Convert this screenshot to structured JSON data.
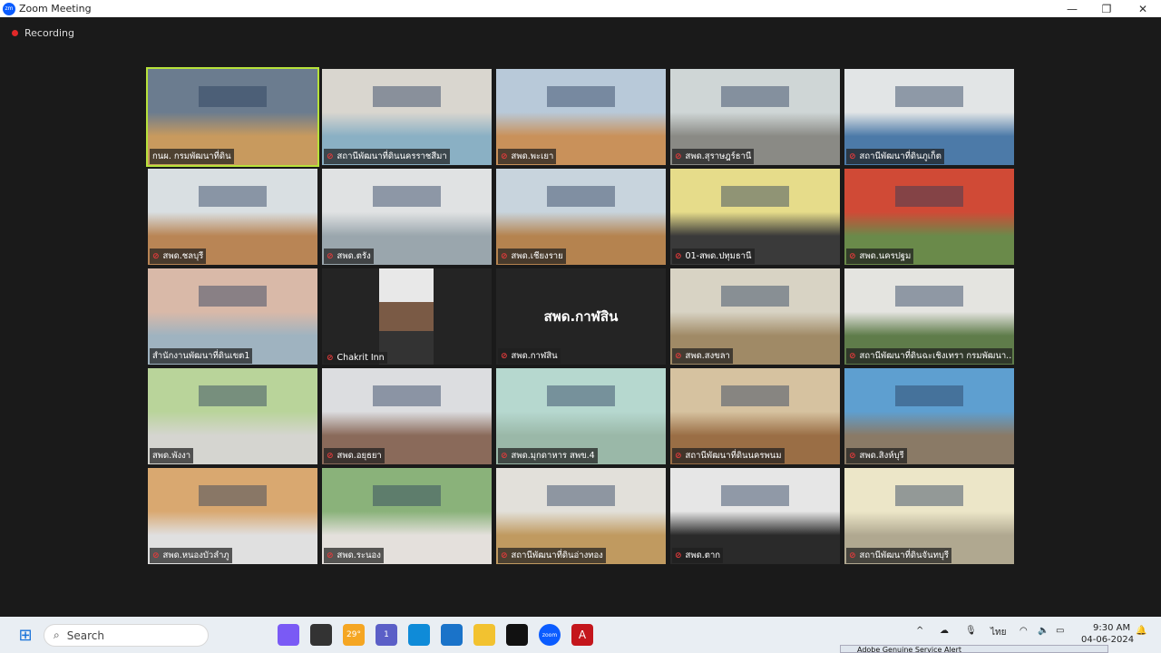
{
  "window": {
    "title": "Zoom Meeting",
    "minimize": "—",
    "maximize": "❐",
    "close": "✕"
  },
  "recording": {
    "label": "Recording",
    "color": "#e02828"
  },
  "active_color": "#b7e23a",
  "tiles": [
    {
      "name": "กนผ. กรมพัฒนาที่ดิน",
      "muted": false,
      "active": true,
      "room": [
        "#6b7c8f",
        "#c89a5e"
      ]
    },
    {
      "name": "สถานีพัฒนาที่ดินนครราชสีมา",
      "muted": true,
      "room": [
        "#d9d6cf",
        "#8ab0c4"
      ]
    },
    {
      "name": "สพด.พะเยา",
      "muted": true,
      "room": [
        "#b8c9d9",
        "#c9915a"
      ]
    },
    {
      "name": "สพด.สุราษฎร์ธานี",
      "muted": true,
      "room": [
        "#cfd6d6",
        "#8a8a85"
      ]
    },
    {
      "name": "สถานีพัฒนาที่ดินภูเก็ต",
      "muted": true,
      "room": [
        "#e2e5e6",
        "#4c7aa8"
      ]
    },
    {
      "name": "สพด.ชลบุรี",
      "muted": true,
      "room": [
        "#d9dfe2",
        "#b98555"
      ]
    },
    {
      "name": "สพด.ตรัง",
      "muted": true,
      "room": [
        "#e0e2e3",
        "#9aa6ad"
      ]
    },
    {
      "name": "สพด.เชียงราย",
      "muted": true,
      "room": [
        "#c8d4dd",
        "#b5834f"
      ]
    },
    {
      "name": "01-สพด.ปทุมธานี",
      "muted": true,
      "room": [
        "#e6dc8a",
        "#3a3a3a"
      ]
    },
    {
      "name": "สพด.นครปฐม",
      "muted": true,
      "room": [
        "#d04a36",
        "#6a8a4a"
      ]
    },
    {
      "name": "สำนักงานพัฒนาที่ดินเขต1",
      "muted": false,
      "room": [
        "#d9b9a8",
        "#9fb3c0"
      ]
    },
    {
      "name": "Chakrit Inn",
      "muted": true,
      "type": "small-video",
      "room": [
        "#2b2b2b",
        "#2b2b2b"
      ]
    },
    {
      "name": "สพด.กาฬสิน",
      "muted": true,
      "type": "name-only",
      "big_name": "สพด.กาฬสิน"
    },
    {
      "name": "สพด.สงขลา",
      "muted": true,
      "room": [
        "#d8d3c4",
        "#a08a66"
      ]
    },
    {
      "name": "สถานีพัฒนาที่ดินฉะเชิงเทรา กรมพัฒนา...",
      "muted": true,
      "room": [
        "#e4e4e0",
        "#5f7c4a"
      ]
    },
    {
      "name": "สพด.พังงา",
      "muted": false,
      "room": [
        "#b9d49a",
        "#d5d5d0"
      ]
    },
    {
      "name": "สพด.อยุธยา",
      "muted": true,
      "room": [
        "#dcdde0",
        "#8a6a5a"
      ]
    },
    {
      "name": "สพด.มุกดาหาร สพข.4",
      "muted": true,
      "room": [
        "#b6d8cf",
        "#9ab8a8"
      ]
    },
    {
      "name": "สถานีพัฒนาที่ดินนครพนม",
      "muted": true,
      "room": [
        "#d6c2a0",
        "#9a6e45"
      ]
    },
    {
      "name": "สพด.สิงห์บุรี",
      "muted": true,
      "room": [
        "#5e9fd0",
        "#8a7a66"
      ]
    },
    {
      "name": "สพด.หนองบัวลำภู",
      "muted": true,
      "room": [
        "#d9a870",
        "#e0e0e0"
      ]
    },
    {
      "name": "สพด.ระนอง",
      "muted": true,
      "room": [
        "#8ab27a",
        "#e4e0dc"
      ]
    },
    {
      "name": "สถานีพัฒนาที่ดินอ่างทอง",
      "muted": true,
      "room": [
        "#e2e0da",
        "#c09a60"
      ]
    },
    {
      "name": "สพด.ตาก",
      "muted": true,
      "room": [
        "#e6e6e6",
        "#2a2a2a"
      ]
    },
    {
      "name": "สถานีพัฒนาที่ดินจันทบุรี",
      "muted": true,
      "room": [
        "#ece6c8",
        "#b0a890"
      ]
    }
  ],
  "taskbar": {
    "search_placeholder": "Search",
    "weather": "29°",
    "teams_badge": "1",
    "tray_lang": "ไทย",
    "time": "9:30 AM",
    "date": "04-06-2024",
    "notification": "Adobe Genuine Service Alert",
    "apps": [
      {
        "icon": "copilot-icon",
        "color": "#7a5af5"
      },
      {
        "icon": "terminal-icon",
        "color": "#333333"
      },
      {
        "icon": "weather-icon",
        "color": "#f5a623"
      },
      {
        "icon": "teams-icon",
        "color": "#5b5fc7"
      },
      {
        "icon": "edge-icon",
        "color": "#0f8bd8"
      },
      {
        "icon": "mail-icon",
        "color": "#1a73c9"
      },
      {
        "icon": "file-explorer-icon",
        "color": "#f2c230"
      },
      {
        "icon": "capcut-icon",
        "color": "#111111"
      },
      {
        "icon": "zoom-icon",
        "color": "#0b5cff"
      },
      {
        "icon": "acrobat-icon",
        "color": "#c4161c"
      }
    ]
  }
}
